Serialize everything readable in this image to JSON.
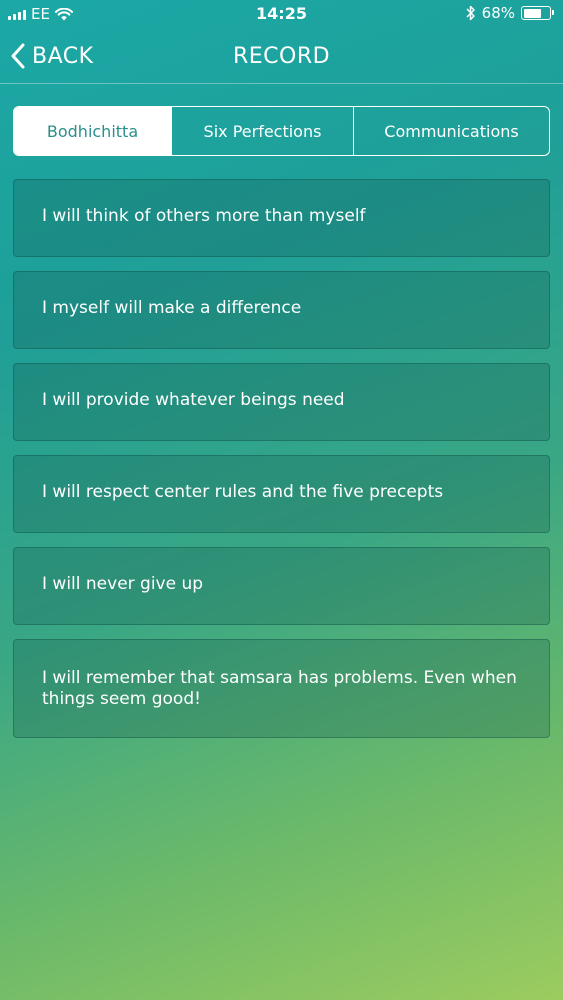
{
  "status_bar": {
    "carrier": "EE",
    "time": "14:25",
    "battery_text": "68%",
    "battery_level": 0.68
  },
  "nav": {
    "back_label": "BACK",
    "title": "RECORD"
  },
  "tabs": [
    {
      "label": "Bodhichitta",
      "selected": true
    },
    {
      "label": "Six Perfections",
      "selected": false
    },
    {
      "label": "Communications",
      "selected": false
    }
  ],
  "items": [
    {
      "text": "I will think of others more than myself"
    },
    {
      "text": "I myself will make a difference"
    },
    {
      "text": "I will provide whatever beings need"
    },
    {
      "text": "I will respect center rules and the five precepts"
    },
    {
      "text": "I will never give up"
    },
    {
      "text": "I will remember that samsara has problems. Even when things seem good!"
    }
  ],
  "colors": {
    "gradient_top": "#1ba8a6",
    "gradient_bottom": "#9ccc5f",
    "active_tab_text": "#2a8f8c"
  }
}
